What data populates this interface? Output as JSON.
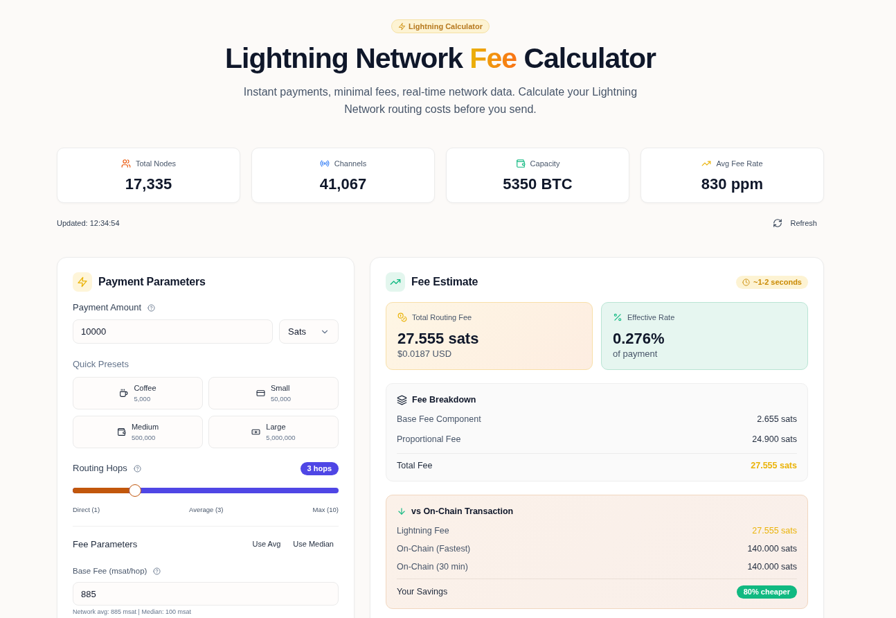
{
  "header": {
    "badge": "Lightning Calculator",
    "title": [
      {
        "text": "Lightning Network",
        "accent": false
      },
      {
        "text": "Fee",
        "accent": true
      },
      {
        "text": "Calculator",
        "accent": false
      }
    ],
    "subtitle": "Instant payments, minimal fees, real-time network data. Calculate your Lightning Network routing costs before you send."
  },
  "stats": [
    {
      "kind": "nodes",
      "label": "Total Nodes",
      "value": "17,335"
    },
    {
      "kind": "channels",
      "label": "Channels",
      "value": "41,067"
    },
    {
      "kind": "capacity",
      "label": "Capacity",
      "value": "5350 BTC"
    },
    {
      "kind": "fee_rate",
      "label": "Avg Fee Rate",
      "value": "830 ppm"
    }
  ],
  "status": {
    "updated": "Updated: 12:34:54",
    "refresh_button": "Refresh"
  },
  "payment_parameters": {
    "title": "Payment Parameters",
    "amount": {
      "label": "Payment Amount",
      "value": "10000",
      "unit": "Sats"
    },
    "presets_label": "Quick Presets",
    "presets": [
      {
        "kind": "coffee",
        "name": "Coffee",
        "amount": "5,000"
      },
      {
        "kind": "small",
        "name": "Small",
        "amount": "50,000"
      },
      {
        "kind": "medium",
        "name": "Medium",
        "amount": "500,000"
      },
      {
        "kind": "large",
        "name": "Large",
        "amount": "5,000,000"
      }
    ],
    "hops": {
      "label": "Routing Hops",
      "badge": "3 hops",
      "level": 0.222,
      "scale": [
        "Direct (1)",
        "Average (3)",
        "Max (10)"
      ]
    },
    "fee_parameters": {
      "label": "Fee Parameters",
      "buttons": [
        "Use Avg",
        "Use Median"
      ]
    },
    "base_fee": {
      "label": "Base Fee (msat/hop)",
      "value": "885",
      "hint": "Network avg: 885 msat | Median: 100 msat"
    }
  },
  "fee_estimate": {
    "title": "Fee Estimate",
    "eta_badge": "~1-2 seconds",
    "summary_cards": [
      {
        "kind": "fee",
        "label": "Total Routing Fee",
        "value": "27.555 sats",
        "sub": "$0.0187 USD"
      },
      {
        "kind": "rate",
        "label": "Effective Rate",
        "value": "0.276%",
        "sub": "of payment"
      }
    ],
    "breakdown": {
      "title": "Fee Breakdown",
      "rows": [
        {
          "label": "Base Fee Component",
          "value": "2.655 sats"
        },
        {
          "label": "Proportional Fee",
          "value": "24.900 sats"
        }
      ],
      "total": {
        "label": "Total Fee",
        "value": "27.555 sats"
      }
    },
    "comparison": {
      "title": "vs On-Chain Transaction",
      "rows": [
        {
          "label": "Lightning Fee",
          "value": "27.555 sats",
          "highlight": true
        },
        {
          "label": "On-Chain (Fastest)",
          "value": "140.000 sats",
          "highlight": false
        },
        {
          "label": "On-Chain (30 min)",
          "value": "140.000 sats",
          "highlight": false
        }
      ],
      "savings": {
        "label": "Your Savings",
        "badge": "80% cheaper"
      }
    }
  }
}
